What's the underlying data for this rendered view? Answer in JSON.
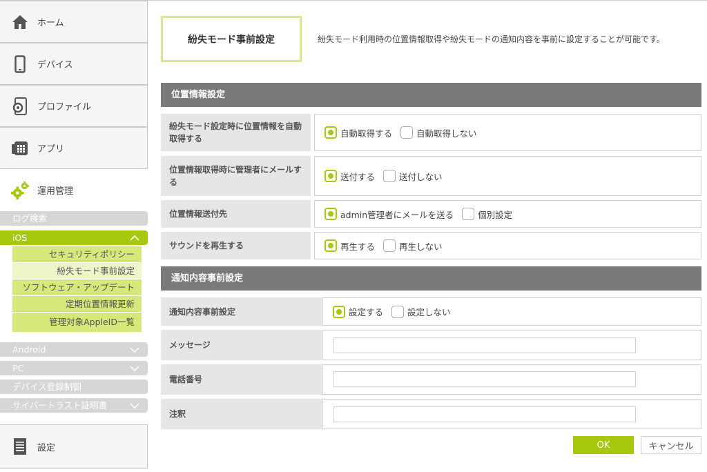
{
  "sidebar": {
    "home": "ホーム",
    "device": "デバイス",
    "profile": "プロファイル",
    "app": "アプリ",
    "ops": "運用管理",
    "log_search": "ログ検索",
    "ios": "iOS",
    "ios_items": [
      "セキュリティポリシー",
      "紛失モード事前設定",
      "ソフトウェア・アップデート",
      "定期位置情報更新",
      "管理対象AppleID一覧"
    ],
    "android": "Android",
    "pc": "PC",
    "device_reg": "デバイス登録制御",
    "cybertrust": "サイバートラスト証明書",
    "settings": "設定"
  },
  "header": {
    "title": "紛失モード事前設定",
    "description": "紛失モード利用時の位置情報取得や紛失モードの通知内容を事前に設定することが可能です。"
  },
  "location": {
    "heading": "位置情報設定",
    "rows": [
      {
        "label": "紛失モード設定時に位置情報を自動取得する",
        "opt_on": "自動取得する",
        "opt_off": "自動取得しない"
      },
      {
        "label": "位置情報取得時に管理者にメールする",
        "opt_on": "送付する",
        "opt_off": "送付しない"
      },
      {
        "label": "位置情報送付先",
        "opt_on": "admin管理者にメールを送る",
        "opt_off": "個別設定"
      },
      {
        "label": "サウンドを再生する",
        "opt_on": "再生する",
        "opt_off": "再生しない"
      }
    ]
  },
  "notify": {
    "heading": "通知内容事前設定",
    "setting_label": "通知内容事前設定",
    "opt_on": "設定する",
    "opt_off": "設定しない",
    "message_label": "メッセージ",
    "message_value": "",
    "phone_label": "電話番号",
    "phone_value": "",
    "note_label": "注釈",
    "note_value": ""
  },
  "buttons": {
    "ok": "OK",
    "cancel": "キャンセル"
  },
  "colors": {
    "accent": "#a6c80e",
    "accent_light": "#d4e87b",
    "section_header": "#7a7a7a"
  }
}
